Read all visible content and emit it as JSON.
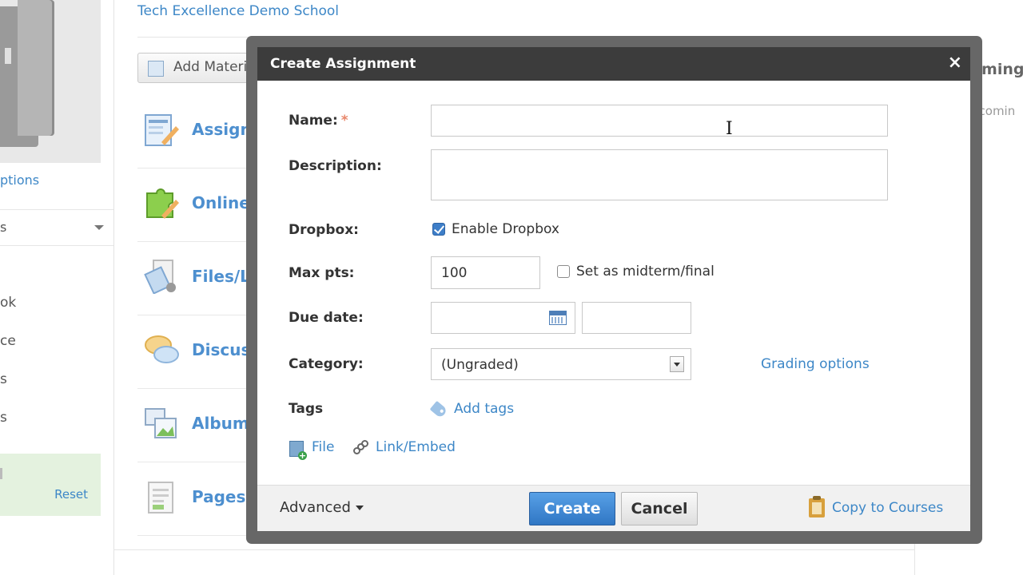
{
  "background": {
    "school_name": "Tech Excellence Demo School",
    "left": {
      "options_link": "ptions",
      "select_fragment": "s",
      "nav_fragments": [
        "ok",
        "ce",
        "s",
        "s"
      ],
      "reset_link": "Reset"
    },
    "add_materials_label": "Add Materi",
    "materials": [
      {
        "label": "Assignm",
        "icon": "assignment-icon"
      },
      {
        "label": "Online T",
        "icon": "puzzle-icon"
      },
      {
        "label": "Files/Li",
        "icon": "files-icon"
      },
      {
        "label": "Discuss",
        "icon": "discussion-icon"
      },
      {
        "label": "Albums",
        "icon": "albums-icon"
      },
      {
        "label": "Pages",
        "icon": "pages-icon"
      }
    ],
    "right": {
      "upcoming_title": "oming",
      "upcoming_text": "pcomin"
    }
  },
  "modal": {
    "title": "Create Assignment",
    "close_glyph": "×",
    "fields": {
      "name_label": "Name:",
      "required_mark": "*",
      "name_value": "",
      "description_label": "Description:",
      "description_value": "",
      "dropbox_label": "Dropbox:",
      "dropbox_checkbox_label": "Enable Dropbox",
      "dropbox_checked": true,
      "maxpts_label": "Max pts:",
      "maxpts_value": "100",
      "midterm_checkbox_label": "Set as midterm/final",
      "midterm_checked": false,
      "duedate_label": "Due date:",
      "duedate_value": "",
      "duetime_value": "",
      "category_label": "Category:",
      "category_value": "(Ungraded)",
      "grading_options_link": "Grading options",
      "tags_label": "Tags",
      "add_tags_link": "Add tags",
      "file_link": "File",
      "link_embed_link": "Link/Embed"
    },
    "footer": {
      "advanced_label": "Advanced",
      "create_label": "Create",
      "cancel_label": "Cancel",
      "copy_label": "Copy to Courses"
    }
  },
  "colors": {
    "link": "#3d87c7",
    "header_bg": "#3c3c3c",
    "primary_button": "#2f76c4",
    "required": "#e8866a"
  }
}
